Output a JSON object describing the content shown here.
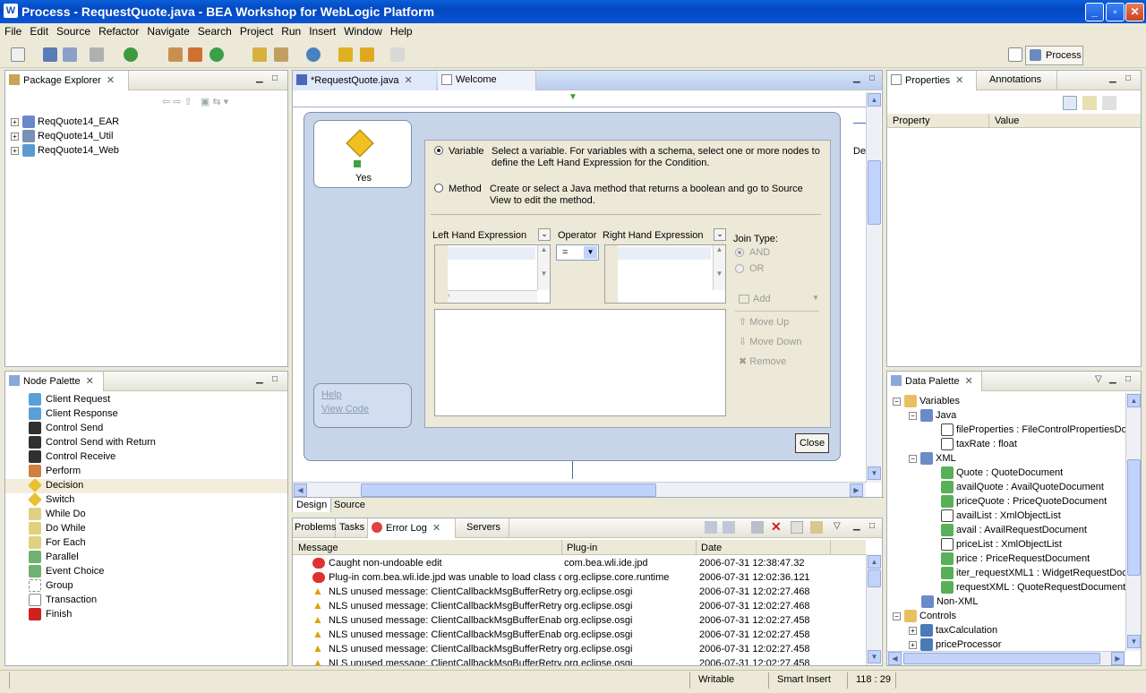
{
  "window": {
    "title": "Process - RequestQuote.java - BEA Workshop for WebLogic Platform"
  },
  "menu": [
    "File",
    "Edit",
    "Source",
    "Refactor",
    "Navigate",
    "Search",
    "Project",
    "Run",
    "Insert",
    "Window",
    "Help"
  ],
  "perspective": {
    "label": "Process"
  },
  "package_explorer": {
    "title": "Package Explorer",
    "items": [
      "ReqQuote14_EAR",
      "ReqQuote14_Util",
      "ReqQuote14_Web"
    ]
  },
  "node_palette": {
    "title": "Node Palette",
    "items": [
      "Client Request",
      "Client Response",
      "Control Send",
      "Control Send with Return",
      "Control Receive",
      "Perform",
      "Decision",
      "Switch",
      "While Do",
      "Do While",
      "For Each",
      "Parallel",
      "Event Choice",
      "Group",
      "Transaction",
      "Finish"
    ]
  },
  "editor": {
    "tabs": [
      "*RequestQuote.java",
      "Welcome"
    ],
    "bottom_tabs": [
      "Design",
      "Source"
    ],
    "side_text": "De",
    "node_label": "Yes",
    "help_link": "Help",
    "view_code_link": "View Code",
    "variable_label": "Variable",
    "variable_desc_1": "Select a variable. For variables with a schema, select one or more nodes to",
    "variable_desc_2": "define the Left Hand Expression for the Condition.",
    "method_label": "Method",
    "method_desc_1": "Create or select a Java method that returns a boolean and go to Source",
    "method_desc_2": "View to edit the method.",
    "lhe_label": "Left Hand Expression",
    "operator_label": "Operator",
    "operator_value": "=",
    "rhe_label": "Right Hand Expression",
    "join_type_label": "Join Type:",
    "and_label": "AND",
    "or_label": "OR",
    "add_label": "Add",
    "move_up_label": "Move Up",
    "move_down_label": "Move Down",
    "remove_label": "Remove",
    "close_label": "Close"
  },
  "properties": {
    "tabs": [
      "Properties",
      "Annotations"
    ],
    "columns": [
      "Property",
      "Value"
    ]
  },
  "data_palette": {
    "title": "Data Palette",
    "variables_label": "Variables",
    "java_label": "Java",
    "java_items": [
      "fileProperties : FileControlPropertiesDo",
      "taxRate : float"
    ],
    "xml_label": "XML",
    "xml_items": [
      "Quote : QuoteDocument",
      "availQuote : AvailQuoteDocument",
      "priceQuote : PriceQuoteDocument",
      "availList : XmlObjectList",
      "avail : AvailRequestDocument",
      "priceList : XmlObjectList",
      "price : PriceRequestDocument",
      "iter_requestXML1 : WidgetRequestDoc",
      "requestXML : QuoteRequestDocument"
    ],
    "nonxml_label": "Non-XML",
    "controls_label": "Controls",
    "control_items": [
      "taxCalculation",
      "priceProcessor"
    ]
  },
  "log": {
    "tabs": [
      "Problems",
      "Tasks",
      "Error Log",
      "Servers"
    ],
    "columns": [
      "Message",
      "Plug-in",
      "Date"
    ],
    "rows": [
      {
        "type": "error",
        "message": "Caught non-undoable edit",
        "plugin": "com.bea.wli.ide.jpd",
        "date": "2006-07-31 12:38:47.32"
      },
      {
        "type": "error",
        "message": "Plug-in com.bea.wli.ide.jpd was unable to load class cc",
        "plugin": "org.eclipse.core.runtime",
        "date": "2006-07-31 12:02:36.121"
      },
      {
        "type": "warning",
        "message": "NLS unused message: ClientCallbackMsgBufferRetryDe",
        "plugin": "org.eclipse.osgi",
        "date": "2006-07-31 12:02:27.468"
      },
      {
        "type": "warning",
        "message": "NLS unused message: ClientCallbackMsgBufferRetryDe",
        "plugin": "org.eclipse.osgi",
        "date": "2006-07-31 12:02:27.468"
      },
      {
        "type": "warning",
        "message": "NLS unused message: ClientCallbackMsgBufferEnableP",
        "plugin": "org.eclipse.osgi",
        "date": "2006-07-31 12:02:27.458"
      },
      {
        "type": "warning",
        "message": "NLS unused message: ClientCallbackMsgBufferEnableP",
        "plugin": "org.eclipse.osgi",
        "date": "2006-07-31 12:02:27.458"
      },
      {
        "type": "warning",
        "message": "NLS unused message: ClientCallbackMsgBufferRetryCr",
        "plugin": "org.eclipse.osgi",
        "date": "2006-07-31 12:02:27.458"
      },
      {
        "type": "warning",
        "message": "NLS unused message: ClientCallbackMsgBufferRetryCr",
        "plugin": "org.eclipse.osgi",
        "date": "2006-07-31 12:02:27.458"
      }
    ]
  },
  "status": {
    "writable": "Writable",
    "insert_mode": "Smart Insert",
    "position": "118 : 29"
  }
}
